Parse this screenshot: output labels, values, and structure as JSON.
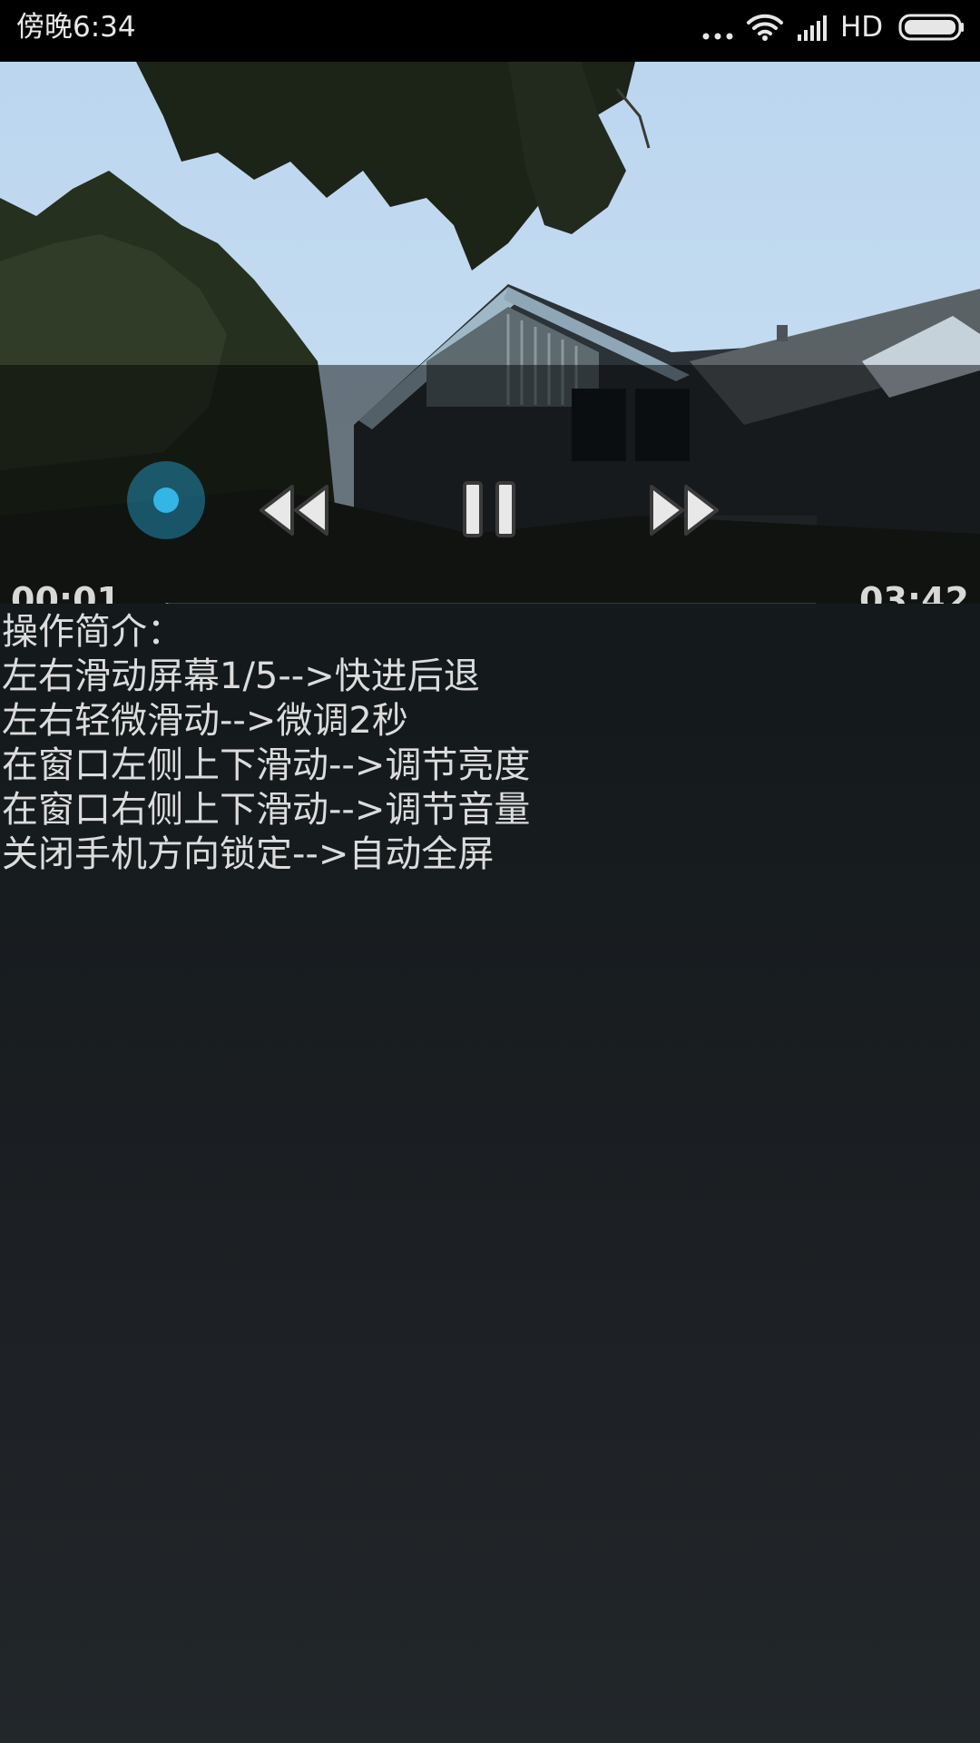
{
  "status_bar": {
    "time": "傍晚6:34",
    "network": "HD",
    "icons": [
      "more-dots-icon",
      "wifi-icon",
      "signal-icon",
      "battery-icon"
    ]
  },
  "player": {
    "current_time": "00:01",
    "total_time": "03:42",
    "progress": 0.005,
    "state": "playing",
    "controls": [
      "rewind-icon",
      "pause-icon",
      "fast-forward-icon"
    ],
    "accent_color": "#33b5e5"
  },
  "instructions": {
    "title": "操作简介：",
    "lines": [
      "左右滑动屏幕1/5-->快进后退",
      "左右轻微滑动-->微调2秒",
      "在窗口左侧上下滑动-->调节亮度",
      "在窗口右侧上下滑动-->调节音量",
      "关闭手机方向锁定-->自动全屏"
    ]
  }
}
